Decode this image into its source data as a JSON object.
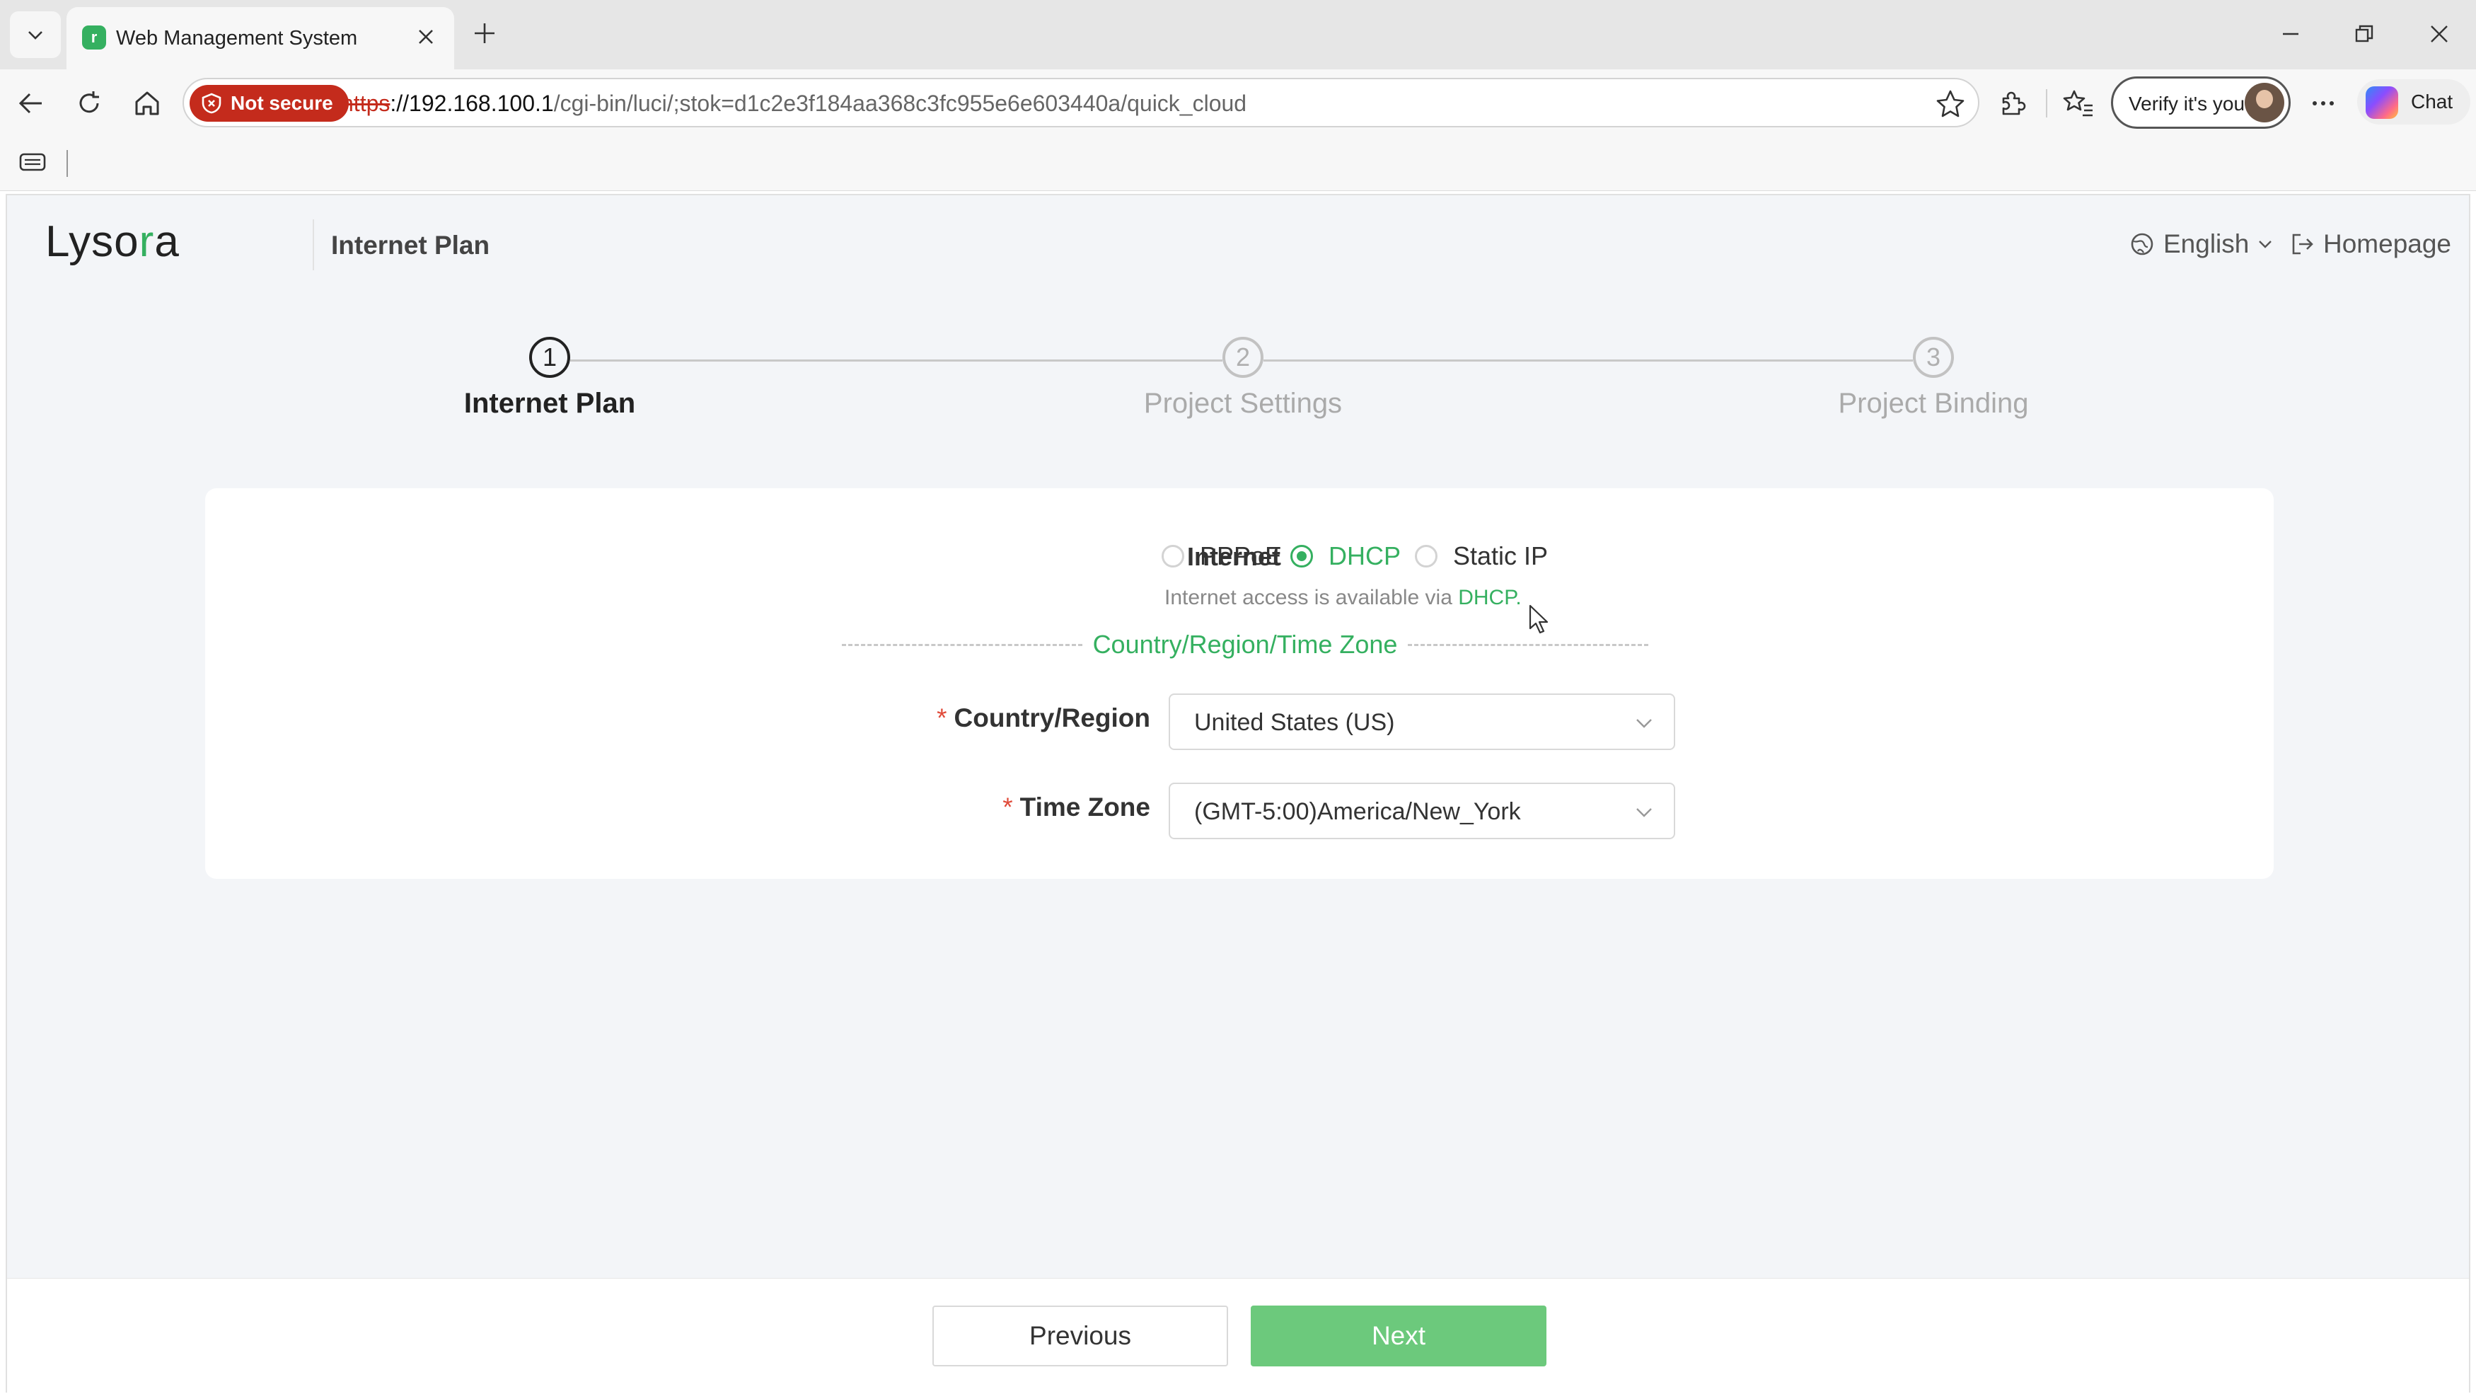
{
  "browser": {
    "tab_title": "Web Management System",
    "tab_favicon_letter": "r",
    "security_label": "Not secure",
    "url_protocol": "https",
    "url_host": "://192.168.100.1",
    "url_path": "/cgi-bin/luci/;stok=d1c2e3f184aa368c3fc955e6e603440a/quick_cloud",
    "profile_label": "Verify it's you",
    "copilot_label": "Chat"
  },
  "app": {
    "logo_prefix": "Lyso",
    "logo_accent": "r",
    "logo_suffix": "a",
    "header_title": "Internet Plan",
    "language": "English",
    "homepage": "Homepage"
  },
  "steps": [
    {
      "number": "1",
      "label": "Internet Plan",
      "active": true
    },
    {
      "number": "2",
      "label": "Project Settings",
      "active": false
    },
    {
      "number": "3",
      "label": "Project Binding",
      "active": false
    }
  ],
  "form": {
    "internet_label": "Internet",
    "options": [
      {
        "label": "PPPoE",
        "checked": false
      },
      {
        "label": "DHCP",
        "checked": true
      },
      {
        "label": "Static IP",
        "checked": false
      }
    ],
    "hint_prefix": "Internet access is available via ",
    "hint_accent": "DHCP.",
    "section_title": "Country/Region/Time Zone",
    "country_label": "Country/Region",
    "country_value": "United States (US)",
    "timezone_label": "Time Zone",
    "timezone_value": "(GMT-5:00)America/New_York",
    "required_mark": "*"
  },
  "footer": {
    "previous_label": "Previous",
    "next_label": "Next"
  },
  "colors": {
    "accent": "#35b060",
    "next_button": "#6cc97c",
    "not_secure": "#c42b1c",
    "required": "#e04b3a"
  }
}
